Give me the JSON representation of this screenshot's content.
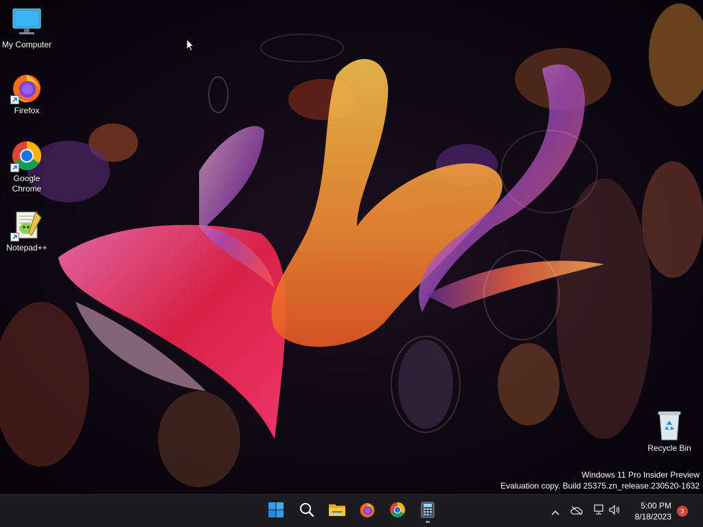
{
  "desktop": {
    "icons": [
      {
        "label": "My Computer",
        "icon": "computer-icon"
      },
      {
        "label": "Firefox",
        "icon": "firefox-icon"
      },
      {
        "label": "Google Chrome",
        "icon": "chrome-icon"
      },
      {
        "label": "Notepad++",
        "icon": "notepadpp-icon"
      },
      {
        "label": "Recycle Bin",
        "icon": "recycle-bin-icon"
      }
    ],
    "watermark": {
      "line1": "Windows 11 Pro Insider Preview",
      "line2": "Evaluation copy. Build 25375.zn_release.230520-1632"
    }
  },
  "taskbar": {
    "apps": [
      {
        "name": "Start",
        "icon": "windows-start-icon"
      },
      {
        "name": "Search",
        "icon": "search-icon"
      },
      {
        "name": "File Explorer",
        "icon": "folder-icon"
      },
      {
        "name": "Firefox",
        "icon": "firefox-icon"
      },
      {
        "name": "Google Chrome",
        "icon": "chrome-icon"
      },
      {
        "name": "Calculator",
        "icon": "calculator-icon"
      }
    ],
    "tray": {
      "time": "5:00 PM",
      "date": "8/18/2023",
      "notification_count": "3"
    }
  },
  "colors": {
    "taskbar_bg": "#1c1c1e",
    "start_blue": "#3a9ae8",
    "badge_red": "#d0473c"
  }
}
